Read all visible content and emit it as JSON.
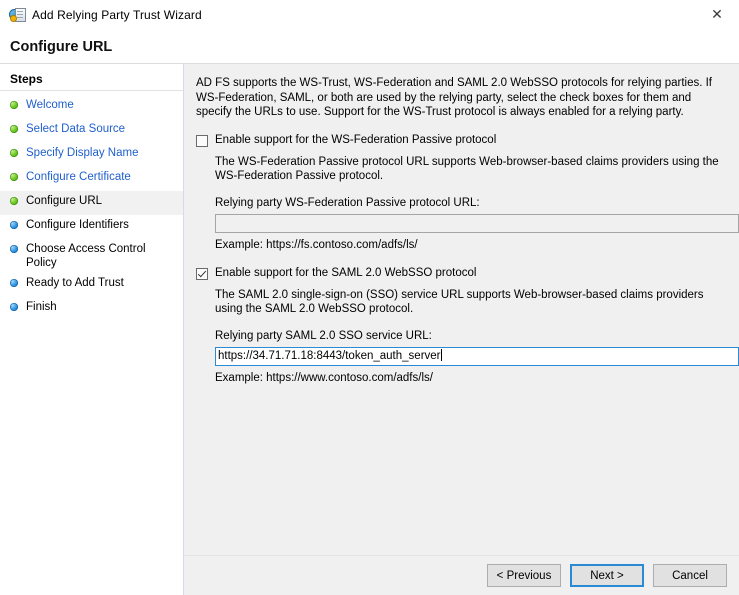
{
  "window": {
    "title": "Add Relying Party Trust Wizard",
    "icon": "relying-party-trust-icon",
    "close_label": "✕"
  },
  "page": {
    "heading": "Configure URL"
  },
  "sidebar": {
    "title": "Steps",
    "items": [
      {
        "label": "Welcome",
        "bullet": "green",
        "state": "done"
      },
      {
        "label": "Select Data Source",
        "bullet": "green",
        "state": "done"
      },
      {
        "label": "Specify Display Name",
        "bullet": "green",
        "state": "done"
      },
      {
        "label": "Configure Certificate",
        "bullet": "green",
        "state": "done"
      },
      {
        "label": "Configure URL",
        "bullet": "green",
        "state": "current"
      },
      {
        "label": "Configure Identifiers",
        "bullet": "blue",
        "state": "pending"
      },
      {
        "label": "Choose Access Control Policy",
        "bullet": "blue",
        "state": "pending"
      },
      {
        "label": "Ready to Add Trust",
        "bullet": "blue",
        "state": "pending"
      },
      {
        "label": "Finish",
        "bullet": "blue",
        "state": "pending"
      }
    ]
  },
  "main": {
    "intro": "AD FS supports the WS-Trust, WS-Federation and SAML 2.0 WebSSO protocols for relying parties.  If WS-Federation, SAML, or both are used by the relying party, select the check boxes for them and specify the URLs to use.  Support for the WS-Trust protocol is always enabled for a relying party.",
    "wsfed": {
      "checkbox_label": "Enable support for the WS-Federation Passive protocol",
      "checked": false,
      "description": "The WS-Federation Passive protocol URL supports Web-browser-based claims providers using the WS-Federation Passive protocol.",
      "field_label": "Relying party WS-Federation Passive protocol URL:",
      "value": "",
      "example": "Example: https://fs.contoso.com/adfs/ls/"
    },
    "saml": {
      "checkbox_label": "Enable support for the SAML 2.0 WebSSO protocol",
      "checked": true,
      "description": "The SAML 2.0 single-sign-on (SSO) service URL supports Web-browser-based claims providers using the SAML 2.0 WebSSO protocol.",
      "field_label": "Relying party SAML 2.0 SSO service URL:",
      "value": "https://34.71.71.18:8443/token_auth_server",
      "example": "Example: https://www.contoso.com/adfs/ls/"
    }
  },
  "footer": {
    "previous_label": "< Previous",
    "next_label": "Next >",
    "cancel_label": "Cancel"
  },
  "colors": {
    "link": "#1f5fcc",
    "accent": "#2a8ad4",
    "pane_bg": "#f0f0f0",
    "bullet_done": "#66c21e",
    "bullet_pending": "#2a8fdd"
  }
}
